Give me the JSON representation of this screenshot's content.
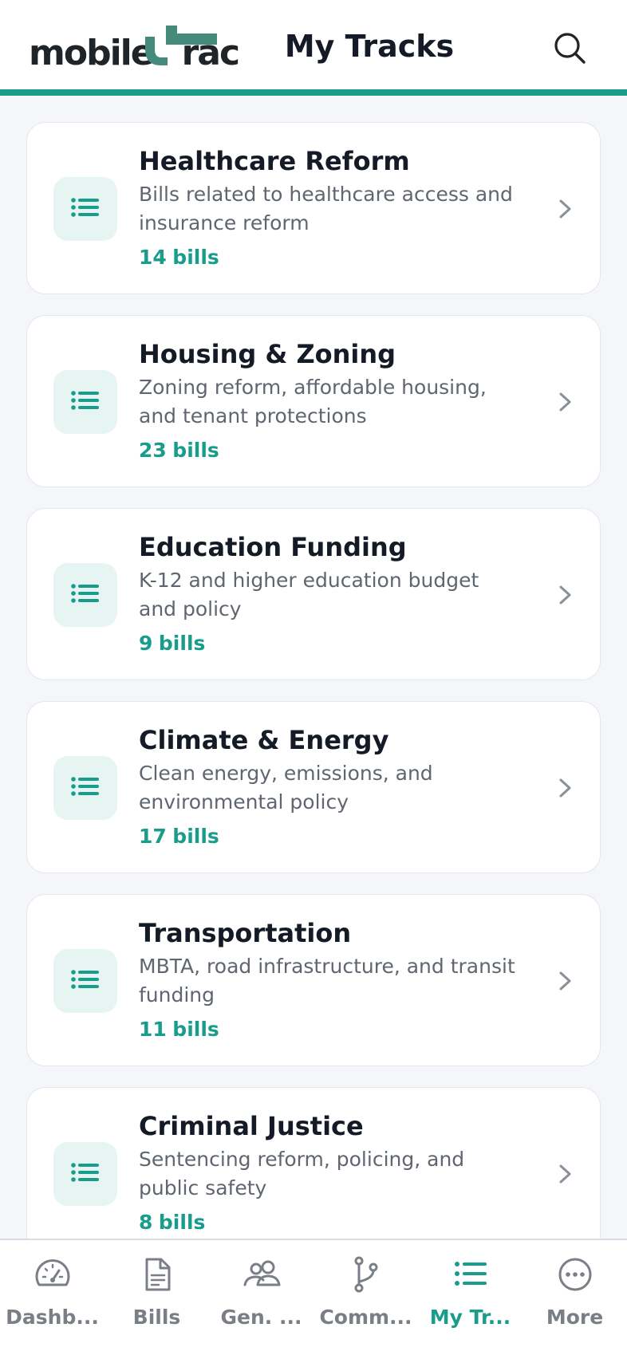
{
  "header": {
    "logo_text_left": "mobile",
    "logo_text_right": "rac",
    "logo_mark_color": "#468a7c",
    "title": "My Tracks",
    "search_icon": "search-icon"
  },
  "tracks": [
    {
      "title": "Healthcare Reform",
      "description": "Bills related to healthcare access and insurance reform",
      "count": "14",
      "unit": "bills"
    },
    {
      "title": "Housing & Zoning",
      "description": "Zoning reform, affordable housing, and tenant protections",
      "count": "23",
      "unit": "bills"
    },
    {
      "title": "Education Funding",
      "description": "K-12 and higher education budget and policy",
      "count": "9",
      "unit": "bills"
    },
    {
      "title": "Climate & Energy",
      "description": "Clean energy, emissions, and environmental policy",
      "count": "17",
      "unit": "bills"
    },
    {
      "title": "Transportation",
      "description": "MBTA, road infrastructure, and transit funding",
      "count": "11",
      "unit": "bills"
    },
    {
      "title": "Criminal Justice",
      "description": "Sentencing reform, policing, and public safety",
      "count": "8",
      "unit": "bills"
    }
  ],
  "tabs": [
    {
      "label": "Dashb...",
      "icon": "dashboard-icon",
      "active": false
    },
    {
      "label": "Bills",
      "icon": "document-icon",
      "active": false
    },
    {
      "label": "Gen. ...",
      "icon": "people-icon",
      "active": false
    },
    {
      "label": "Comm...",
      "icon": "branch-icon",
      "active": false
    },
    {
      "label": "My Tr...",
      "icon": "list-icon",
      "active": true
    },
    {
      "label": "More",
      "icon": "more-icon",
      "active": false
    }
  ],
  "colors": {
    "accent": "#189c8c",
    "background": "#f4f6fa",
    "title_text": "#141a26",
    "muted_text": "#5f6670",
    "tab_inactive": "#7a7f87"
  }
}
